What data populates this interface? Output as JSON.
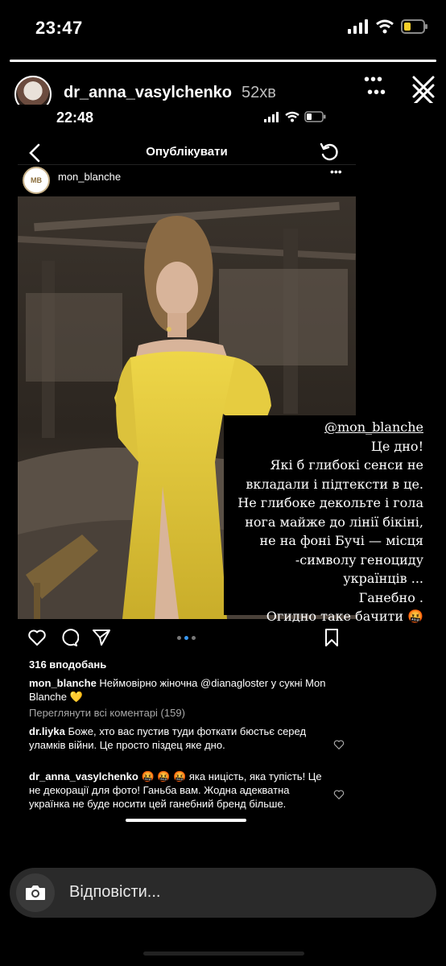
{
  "status_bar": {
    "time": "23:47"
  },
  "story": {
    "progress": 1.0,
    "username": "dr_anna_vasylchenko",
    "time_ago": "52хв",
    "reply_placeholder": "Відповісти..."
  },
  "inner": {
    "status_time": "22:48",
    "nav_title": "Опублікувати",
    "post": {
      "username": "mon_blanche",
      "likes": "316 вподобань",
      "caption_user": "mon_blanche",
      "caption_text": "Неймовірно жіночна @dianagloster у сукні Mon Blanche 💛",
      "view_comments": "Переглянути всі коментарі (159)",
      "comments": [
        {
          "user": "dr.liyka",
          "text": "Боже, хто вас пустив туди фоткати бюстьє серед уламків війни. Це просто піздец яке дно."
        },
        {
          "user": "dr_anna_vasylchenko",
          "text": "🤬 🤬 🤬 яка ницість, яка тупість! Це не декорації для фото! Ганьба вам. Жодна адекватна українка не буде носити цей ганебний бренд більше."
        }
      ]
    }
  },
  "story_text": {
    "mention": "@mon_blanche",
    "lines": [
      "Це дно!",
      "Які б глибокі сенси не",
      "вкладали і підтексти в це.",
      "Не глибоке декольте і гола",
      "нога майже до лінії бікіні,",
      "не на фоні Бучі —  місця",
      "-символу геноциду",
      "українців ...",
      "Ганебно .",
      "Огидно таке бачити 🤬"
    ]
  },
  "colors": {
    "accent": "#3897f0",
    "dress": "#e8cf3a",
    "background": "#000000"
  },
  "icons": [
    "signal-icon",
    "wifi-icon",
    "battery-icon",
    "more-icon",
    "close-icon",
    "back-icon",
    "refresh-icon",
    "heart-icon",
    "comment-icon",
    "share-icon",
    "bookmark-icon",
    "camera-icon"
  ]
}
